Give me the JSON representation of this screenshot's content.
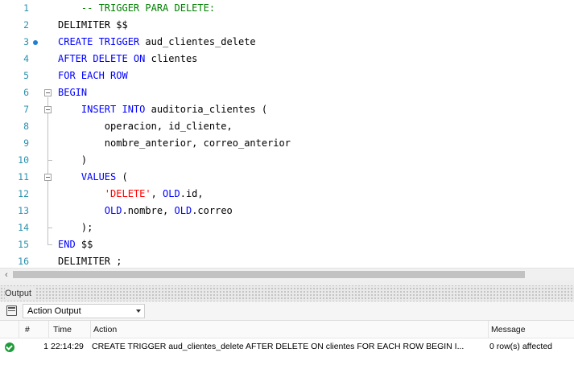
{
  "editor": {
    "lines": [
      {
        "num": "1",
        "tokens": [
          {
            "t": "    -- TRIGGER PARA DELETE:",
            "c": "cm"
          }
        ]
      },
      {
        "num": "2",
        "tokens": [
          {
            "t": "DELIMITER $$",
            "c": "txt"
          }
        ]
      },
      {
        "num": "3",
        "tokens": [
          {
            "t": "CREATE TRIGGER",
            "c": "kw"
          },
          {
            "t": " aud_clientes_delete",
            "c": "txt"
          }
        ]
      },
      {
        "num": "4",
        "tokens": [
          {
            "t": "AFTER DELETE ON",
            "c": "kw"
          },
          {
            "t": " clientes",
            "c": "txt"
          }
        ]
      },
      {
        "num": "5",
        "tokens": [
          {
            "t": "FOR EACH ROW",
            "c": "kw"
          }
        ]
      },
      {
        "num": "6",
        "tokens": [
          {
            "t": "BEGIN",
            "c": "kw"
          }
        ]
      },
      {
        "num": "7",
        "tokens": [
          {
            "t": "    ",
            "c": "txt"
          },
          {
            "t": "INSERT INTO",
            "c": "kw"
          },
          {
            "t": " auditoria_clientes (",
            "c": "txt"
          }
        ]
      },
      {
        "num": "8",
        "tokens": [
          {
            "t": "        operacion, id_cliente,",
            "c": "txt"
          }
        ]
      },
      {
        "num": "9",
        "tokens": [
          {
            "t": "        nombre_anterior, correo_anterior",
            "c": "txt"
          }
        ]
      },
      {
        "num": "10",
        "tokens": [
          {
            "t": "    )",
            "c": "txt"
          }
        ]
      },
      {
        "num": "11",
        "tokens": [
          {
            "t": "    ",
            "c": "txt"
          },
          {
            "t": "VALUES",
            "c": "kw"
          },
          {
            "t": " (",
            "c": "txt"
          }
        ]
      },
      {
        "num": "12",
        "tokens": [
          {
            "t": "        ",
            "c": "txt"
          },
          {
            "t": "'DELETE'",
            "c": "str"
          },
          {
            "t": ", ",
            "c": "txt"
          },
          {
            "t": "OLD",
            "c": "kw"
          },
          {
            "t": ".id,",
            "c": "txt"
          }
        ]
      },
      {
        "num": "13",
        "tokens": [
          {
            "t": "        ",
            "c": "txt"
          },
          {
            "t": "OLD",
            "c": "kw"
          },
          {
            "t": ".nombre, ",
            "c": "txt"
          },
          {
            "t": "OLD",
            "c": "kw"
          },
          {
            "t": ".correo",
            "c": "txt"
          }
        ]
      },
      {
        "num": "14",
        "tokens": [
          {
            "t": "    );",
            "c": "txt"
          }
        ]
      },
      {
        "num": "15",
        "tokens": [
          {
            "t": "END",
            "c": "kw"
          },
          {
            "t": " $$",
            "c": "txt"
          }
        ]
      },
      {
        "num": "16",
        "tokens": [
          {
            "t": "DELIMITER ;",
            "c": "txt"
          }
        ]
      }
    ]
  },
  "output": {
    "title": "Output",
    "selector_value": "Action Output",
    "columns": {
      "num": "#",
      "time": "Time",
      "action": "Action",
      "message": "Message"
    },
    "rows": [
      {
        "status": "success",
        "num": "1",
        "time": "22:14:29",
        "action": "CREATE TRIGGER aud_clientes_delete AFTER DELETE ON clientes FOR EACH ROW BEGIN     I...",
        "message": "0 row(s) affected"
      }
    ]
  },
  "colors": {
    "keyword": "#0000ff",
    "comment": "#008000",
    "string": "#ff0000",
    "line_number": "#2b91af",
    "success": "#1f9c3a"
  },
  "icons": [
    "breakpoint-dot-icon",
    "fold-collapse-icon",
    "output-panel-icon",
    "dropdown-arrow-icon",
    "success-check-icon",
    "scroll-left-icon"
  ]
}
